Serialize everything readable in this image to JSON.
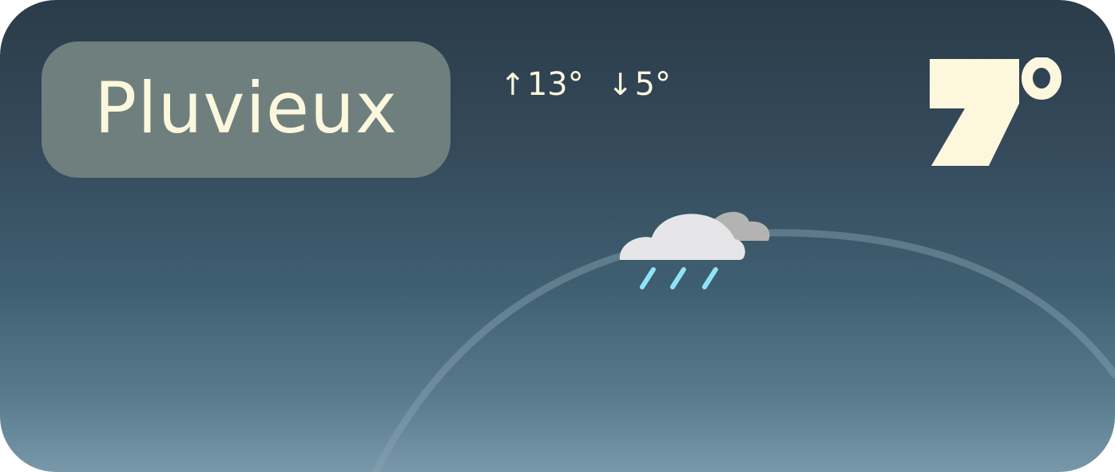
{
  "widget": {
    "condition": "Pluvieux",
    "high_arrow": "↑",
    "high": "13°",
    "low_arrow": "↓",
    "low": "5°",
    "current_temp": "7°"
  },
  "icons": {
    "weather": "cloud-rain-icon"
  },
  "colors": {
    "text_cream": "#fdf7dd",
    "pill": "#6e7f7e",
    "rain": "#8fe3f7",
    "cloud_front": "#e6e6e8",
    "cloud_back": "#b3b3b3"
  }
}
